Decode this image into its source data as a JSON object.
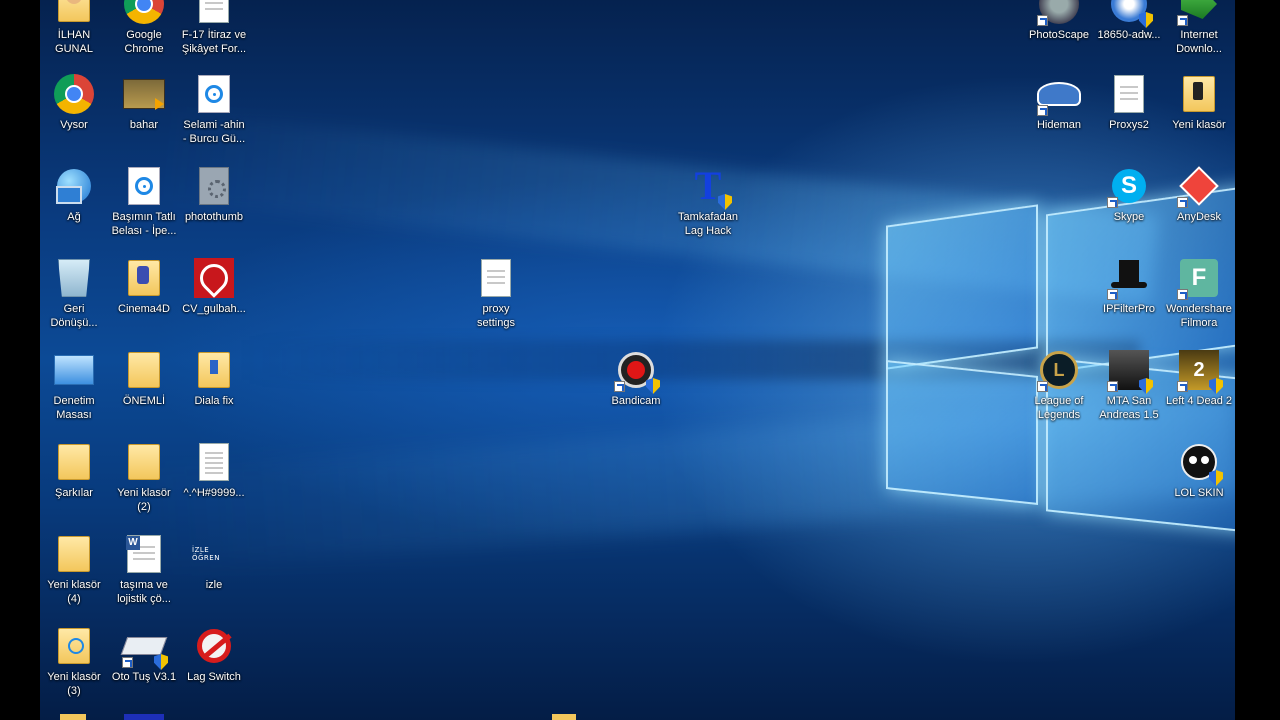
{
  "colors": {
    "wallpaper_dark": "#05224f",
    "wallpaper_mid": "#0c4a96",
    "windows_glow": "#7fd0ff",
    "label_text": "#ffffff"
  },
  "desktop_icons": {
    "left_col1": [
      {
        "name": "ilhan-gunal-icon",
        "label": "İLHAN\nGUNAL",
        "icon": "user-folder-icon"
      },
      {
        "name": "vysor-icon",
        "label": "Vysor",
        "icon": "chrome-icon"
      },
      {
        "name": "ag-icon",
        "label": "Ağ",
        "icon": "network-globe-icon"
      },
      {
        "name": "geri-donusum-icon",
        "label": "Geri\nDönüşü...",
        "icon": "recycle-bin-icon"
      },
      {
        "name": "denetim-masasi-icon",
        "label": "Denetim\nMasası",
        "icon": "control-panel-icon"
      },
      {
        "name": "sarkilar-icon",
        "label": "Şarkılar",
        "icon": "folder-icon"
      },
      {
        "name": "yeni-klasor-4-icon",
        "label": "Yeni klasör\n(4)",
        "icon": "folder-icon"
      },
      {
        "name": "yeni-klasor-3-icon",
        "label": "Yeni klasör\n(3)",
        "icon": "folder-icon"
      }
    ],
    "left_col2": [
      {
        "name": "google-chrome-icon",
        "label": "Google\nChrome",
        "icon": "chrome-icon"
      },
      {
        "name": "bahar-icon",
        "label": "bahar",
        "icon": "video-folder-icon"
      },
      {
        "name": "basimin-tatli-belasi-icon",
        "label": "Başımın Tatlı\nBelası - İpe...",
        "icon": "media-file-icon"
      },
      {
        "name": "cinema4d-icon",
        "label": "Cinema4D",
        "icon": "folder-icon"
      },
      {
        "name": "onemli-icon",
        "label": "ÖNEMLİ",
        "icon": "folder-icon"
      },
      {
        "name": "yeni-klasor-2-icon",
        "label": "Yeni klasör\n(2)",
        "icon": "folder-icon"
      },
      {
        "name": "tasima-lojistik-icon",
        "label": "taşıma ve\nlojistik çö...",
        "icon": "word-document-icon"
      },
      {
        "name": "oto-tus-icon",
        "label": "Oto Tuş V3.1",
        "icon": "keyboard-icon"
      }
    ],
    "left_col3": [
      {
        "name": "f17-itiraz-icon",
        "label": "F-17 İtiraz ve\nŞikâyet For...",
        "icon": "document-icon"
      },
      {
        "name": "selami-sahin-icon",
        "label": "Selami -ahin\n- Burcu Gü...",
        "icon": "media-file-icon"
      },
      {
        "name": "photothumb-icon",
        "label": "photothumb",
        "icon": "settings-file-icon"
      },
      {
        "name": "cv-gulbah-icon",
        "label": "CV_gulbah...",
        "icon": "pdf-icon"
      },
      {
        "name": "diala-fix-icon",
        "label": "Diala fix",
        "icon": "folder-icon"
      },
      {
        "name": "caret-h-9999-icon",
        "label": "^.^H#9999...",
        "icon": "document-icon"
      },
      {
        "name": "izle-icon",
        "label": "izle",
        "icon": "izle-ogren-icon"
      },
      {
        "name": "lag-switch-icon",
        "label": "Lag Switch",
        "icon": "prohibited-icon"
      }
    ],
    "middle": [
      {
        "name": "proxy-settings-icon",
        "label": "proxy\nsettings",
        "icon": "document-icon"
      },
      {
        "name": "tamkafadan-lag-hack-icon",
        "label": "Tamkafadan\nLag Hack",
        "icon": "letter-t-icon"
      },
      {
        "name": "bandicam-icon",
        "label": "Bandicam",
        "icon": "bandicam-icon"
      }
    ],
    "right_col1": [
      {
        "name": "photoscape-icon",
        "label": "PhotoScape",
        "icon": "photoscape-icon"
      },
      {
        "name": "hideman-icon",
        "label": "Hideman",
        "icon": "spy-hat-icon"
      },
      {
        "name": "league-of-legends-icon",
        "label": "League of\nLegends",
        "icon": "lol-logo-icon"
      }
    ],
    "right_col2": [
      {
        "name": "18650-adw-icon",
        "label": "18650-adw...",
        "icon": "installer-icon"
      },
      {
        "name": "proxys2-icon",
        "label": "Proxys2",
        "icon": "document-icon"
      },
      {
        "name": "skype-icon",
        "label": "Skype",
        "icon": "skype-icon"
      },
      {
        "name": "ipfilterpro-icon",
        "label": "IPFilterPro",
        "icon": "top-hat-icon"
      },
      {
        "name": "mta-san-andreas-icon",
        "label": "MTA San\nAndreas 1.5",
        "icon": "mta-icon"
      }
    ],
    "right_col3": [
      {
        "name": "internet-download-icon",
        "label": "Internet\nDownlo...",
        "icon": "idm-icon"
      },
      {
        "name": "yeni-klasor-icon",
        "label": "Yeni klasör",
        "icon": "folder-icon"
      },
      {
        "name": "anydesk-icon",
        "label": "AnyDesk",
        "icon": "anydesk-icon"
      },
      {
        "name": "wondershare-filmora-icon",
        "label": "Wondershare\nFilmora",
        "icon": "filmora-icon"
      },
      {
        "name": "left-4-dead-2-icon",
        "label": "Left 4 Dead 2",
        "icon": "l4d2-icon"
      },
      {
        "name": "lol-skin-icon",
        "label": "LOL SKIN",
        "icon": "lol-skin-icon"
      }
    ]
  }
}
